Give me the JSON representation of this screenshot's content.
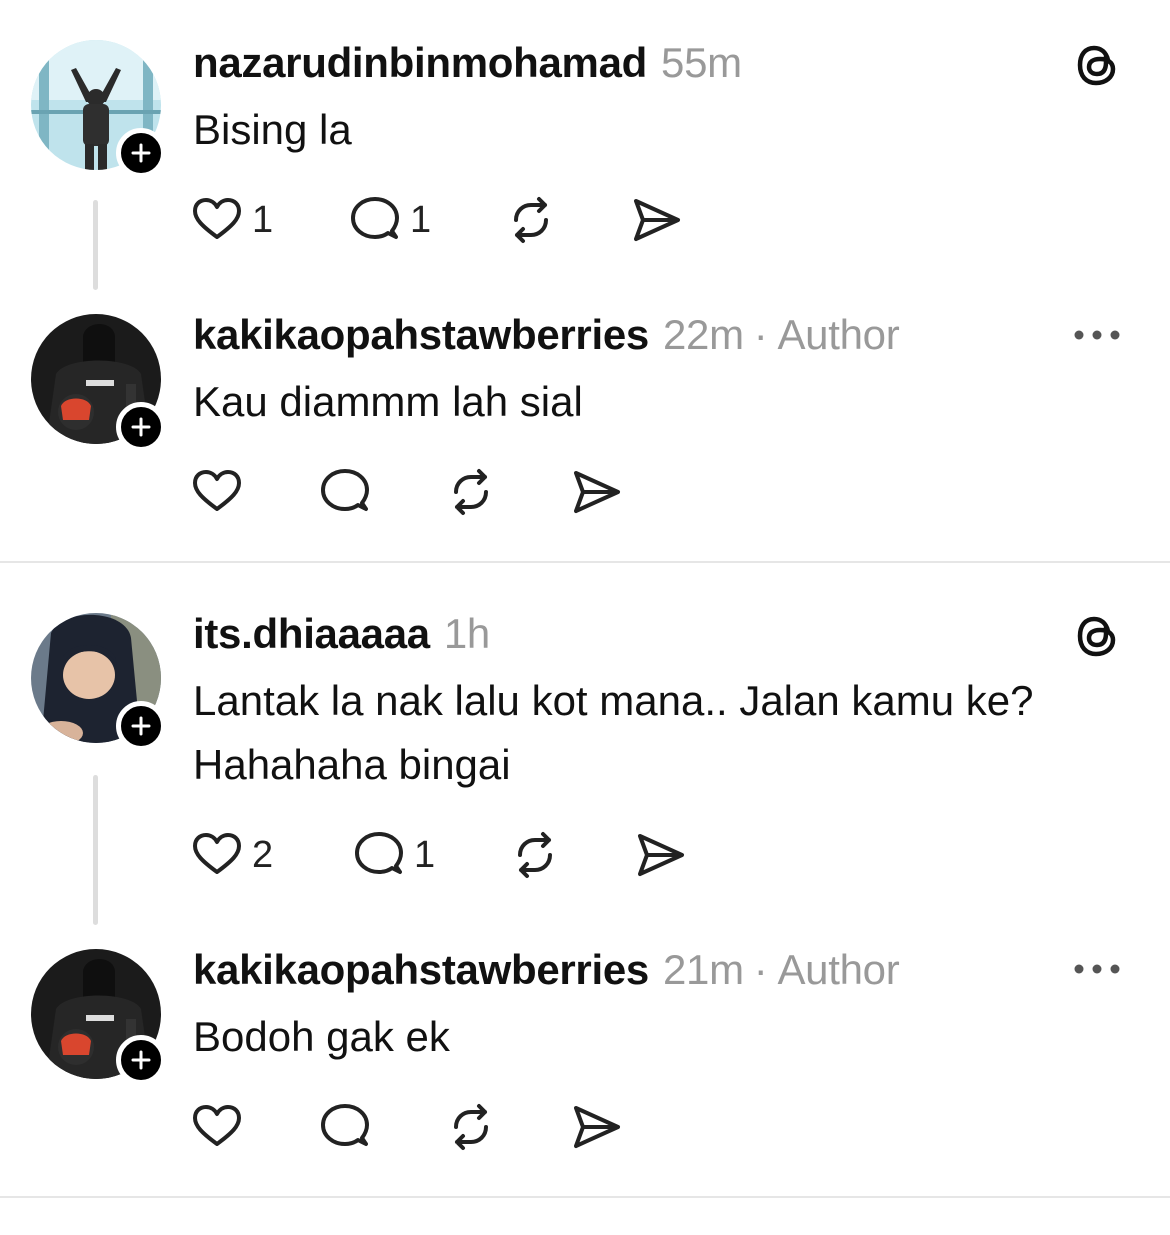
{
  "posts": [
    {
      "username": "nazarudinbinmohamad",
      "time": "55m",
      "author_tag": "",
      "text": [
        "Bising la"
      ],
      "likes": "1",
      "replies": "1",
      "corner_icon": "threads-logo-icon"
    },
    {
      "username": "kakikaopahstawberries",
      "time": "22m",
      "author_tag": "Author",
      "text": [
        "Kau diammm lah sial"
      ],
      "likes": "",
      "replies": "",
      "corner_icon": "more-options-icon"
    },
    {
      "username": "its.dhiaaaaa",
      "time": "1h",
      "author_tag": "",
      "text": [
        "Lantak la nak lalu kot mana.. Jalan kamu ke?",
        "Hahahaha bingai"
      ],
      "likes": "2",
      "replies": "1",
      "corner_icon": "threads-logo-icon"
    },
    {
      "username": "kakikaopahstawberries",
      "time": "21m",
      "author_tag": "Author",
      "text": [
        "Bodoh gak ek"
      ],
      "likes": "",
      "replies": "",
      "corner_icon": "more-options-icon"
    }
  ],
  "colors": {
    "text": "#111111",
    "muted": "#999999",
    "thread_line": "#dddddd",
    "divider": "#e6e6e6"
  }
}
